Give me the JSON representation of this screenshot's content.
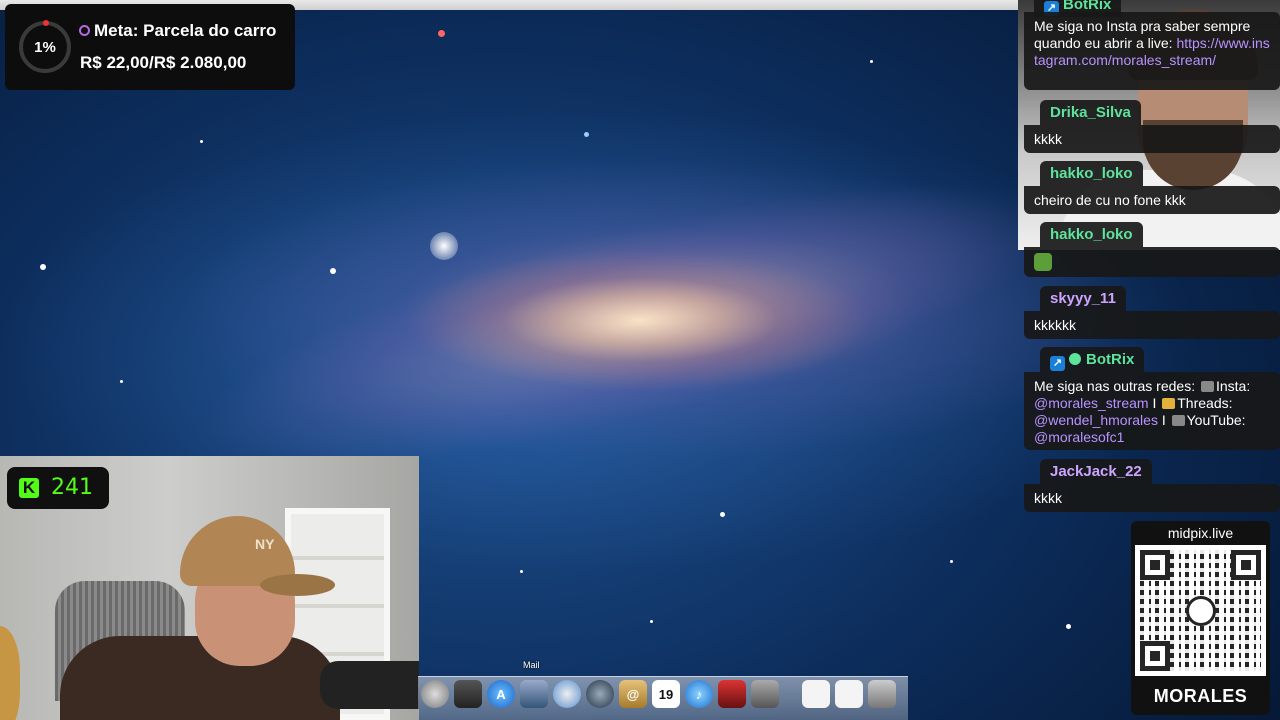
{
  "goal": {
    "percent": "1%",
    "title": "Meta: Parcela do carro",
    "amount": "R$ 22,00/R$ 2.080,00"
  },
  "viewers": {
    "count": "241",
    "icon": "kick-icon"
  },
  "chat": {
    "messages": [
      {
        "user": "BotRix",
        "text_parts": [
          "Me siga no Insta pra saber sempre quando eu abrir a live: "
        ],
        "link": "https://www.instagram.com/morales_stream/"
      },
      {
        "user": "Drika_Silva",
        "text": "kkkk"
      },
      {
        "user": "hakko_loko",
        "text": "cheiro de cu no fone kkk"
      },
      {
        "user": "hakko_loko",
        "text": ""
      },
      {
        "user": "skyyy_11",
        "text": "kkkkkk"
      },
      {
        "user": "BotRix",
        "text": "Me siga nas outras redes:",
        "insta_label": "Insta:",
        "insta_handle": "@morales_stream",
        "sep": "I",
        "threads_label": "Threads:",
        "threads_handle": "@wendel_hmorales",
        "youtube_label": "YouTube:",
        "youtube_handle": "@moralesofc1"
      },
      {
        "user": "JackJack_22",
        "text": "kkkk"
      }
    ]
  },
  "qr": {
    "url": "midpix.live",
    "brand": "MORALES"
  },
  "dock": {
    "tooltip": "Mail",
    "calendar_day": "19",
    "icons": [
      "finder-icon",
      "dashboard-icon",
      "app-store-icon",
      "mail-icon",
      "safari-icon",
      "facetime-icon",
      "contacts-icon",
      "calendar-icon",
      "itunes-icon",
      "photo-booth-icon",
      "preview-icon",
      "document-icon",
      "spreadsheet-icon",
      "trash-icon"
    ]
  },
  "colors": {
    "kick_green": "#53fc18",
    "chat_green": "#5ee39b",
    "chat_purple": "#cda5ff",
    "link": "#b892ff"
  }
}
